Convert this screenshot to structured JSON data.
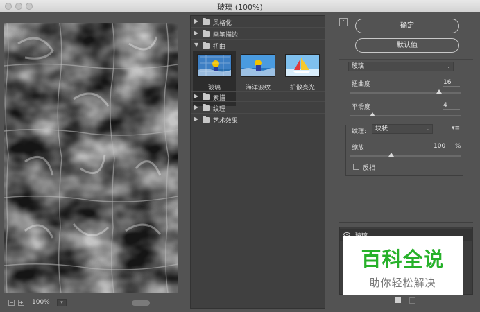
{
  "window": {
    "title": "玻璃 (100%)"
  },
  "preview": {
    "zoom": "100%"
  },
  "gallery": {
    "categories_top": [
      {
        "label": "风格化",
        "expanded": false
      },
      {
        "label": "画笔描边",
        "expanded": false
      },
      {
        "label": "扭曲",
        "expanded": true
      }
    ],
    "thumbnails": [
      {
        "label": "玻璃",
        "selected": true
      },
      {
        "label": "海洋波纹",
        "selected": false
      },
      {
        "label": "扩散亮光",
        "selected": false
      }
    ],
    "categories_bottom": [
      {
        "label": "素描",
        "expanded": false
      },
      {
        "label": "纹理",
        "expanded": false
      },
      {
        "label": "艺术效果",
        "expanded": false
      }
    ]
  },
  "buttons": {
    "ok": "确定",
    "default": "默认值"
  },
  "filter": {
    "selected": "玻璃",
    "distortion_label": "扭曲度",
    "distortion_value": "16",
    "distortion_fraction": 0.8,
    "smoothness_label": "平滑度",
    "smoothness_value": "4",
    "smoothness_fraction": 0.2,
    "texture_label": "纹理:",
    "texture_value": "块状",
    "scaling_label": "缩放",
    "scaling_value": "100",
    "scaling_unit": "%",
    "scaling_fraction": 0.37,
    "invert_label": "反相",
    "invert_checked": false
  },
  "layers": {
    "items": [
      {
        "name": "玻璃",
        "visible": true
      }
    ]
  },
  "watermark": {
    "title": "百科全说",
    "subtitle": "助你轻松解决"
  },
  "colors": {
    "panel_bg": "#535353",
    "preview_bg": "#1a1a1a",
    "watermark_green": "#27b12a"
  }
}
